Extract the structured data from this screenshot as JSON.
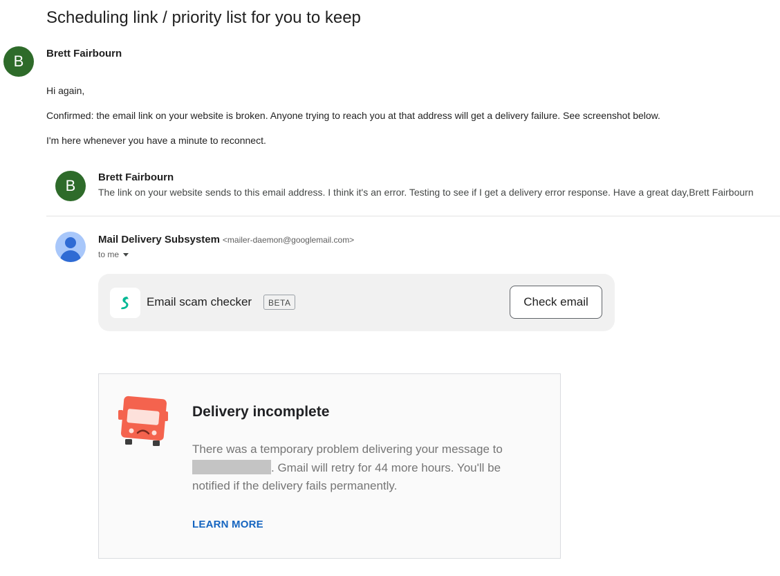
{
  "subject": "Scheduling link / priority list for you to keep",
  "message": {
    "avatar_initial": "B",
    "sender": "Brett Fairbourn",
    "lines": [
      "Hi again,",
      "Confirmed: the email link on your website is broken. Anyone trying to reach you at that address will get a delivery failure. See screenshot below.",
      "I'm here whenever you have a minute to reconnect."
    ]
  },
  "quoted": {
    "original": {
      "avatar_initial": "B",
      "sender": "Brett Fairbourn",
      "snippet": "The link on your website sends to this email address. I think it's an error. Testing to see if I get a delivery error response. Have a great day,Brett Fairbourn"
    },
    "bounce": {
      "sender_name": "Mail Delivery Subsystem",
      "sender_address": "<mailer-daemon@googlemail.com>",
      "recipient_label": "to me"
    }
  },
  "scam_checker": {
    "title": "Email scam checker",
    "badge": "BETA",
    "button_label": "Check email"
  },
  "delivery": {
    "title": "Delivery incomplete",
    "text_before": "There was a temporary problem delivering your message to",
    "text_after": ". Gmail will retry for 44 more hours. You'll be notified if the delivery fails permanently.",
    "link_label": "LEARN MORE"
  },
  "colors": {
    "avatar_green": "#2e6b2a",
    "avatar_blue_bg": "#a8c7fa",
    "avatar_blue_fg": "#2f6bd4",
    "link_blue": "#1565c0",
    "truck_red": "#f4634e",
    "scam_logo_green": "#00b894"
  },
  "icons": {
    "truck": "sad-delivery-truck-icon",
    "scam_logo": "scam-checker-logo-icon",
    "person": "person-avatar-icon",
    "caret": "caret-down-icon"
  }
}
